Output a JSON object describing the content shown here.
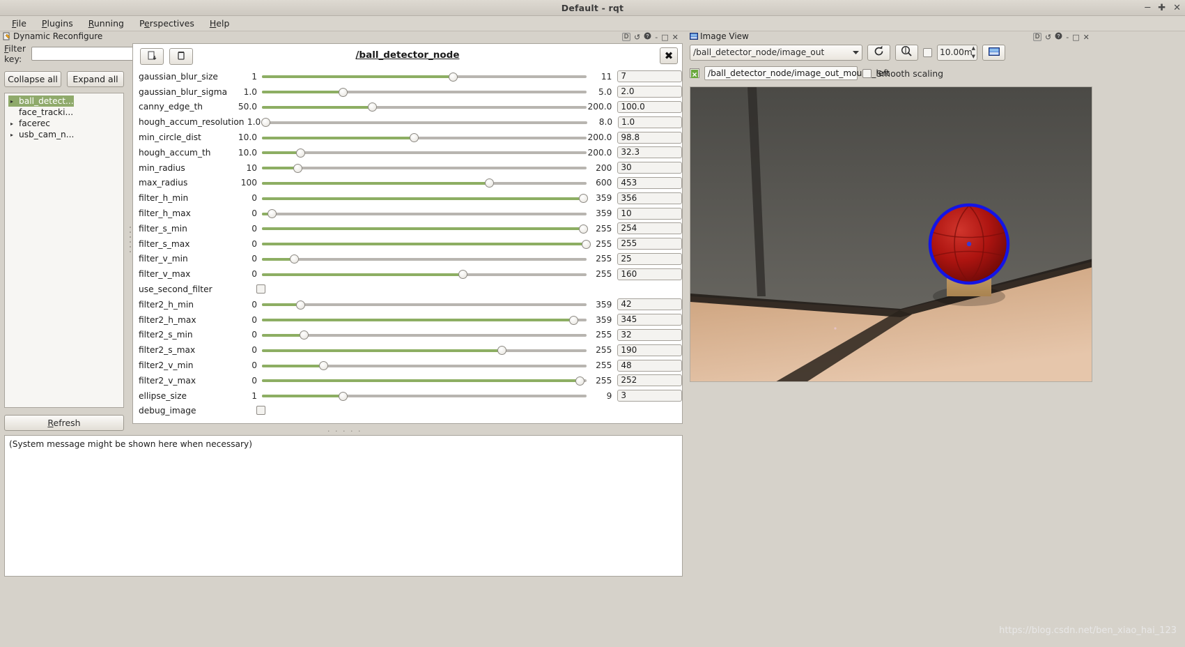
{
  "window": {
    "title": "Default - rqt",
    "buttons": [
      "minimize",
      "maximize",
      "close"
    ],
    "min_glyph": "─",
    "max_glyph": "✚",
    "close_glyph": "✕"
  },
  "menubar": {
    "items": [
      {
        "label": "File",
        "accel": "F"
      },
      {
        "label": "Plugins",
        "accel": "P"
      },
      {
        "label": "Running",
        "accel": "R"
      },
      {
        "label": "Perspectives",
        "accel": "e"
      },
      {
        "label": "Help",
        "accel": "H"
      }
    ]
  },
  "docks": {
    "dynamic_reconfigure": {
      "title": "Dynamic Reconfigure",
      "icon": "dynamic-reconfigure-icon",
      "buttons": [
        "D",
        "↺",
        "?",
        "-",
        "□",
        "✕"
      ]
    },
    "image_view": {
      "title": "Image View",
      "icon": "image-view-icon",
      "buttons": [
        "D",
        "↺",
        "?",
        "-",
        "□",
        "✕"
      ]
    }
  },
  "sidebar": {
    "filter_label": "Filter key:",
    "filter_value": "",
    "filter_placeholder": "",
    "collapse_all": "Collapse all",
    "expand_all": "Expand all",
    "refresh": "Refresh",
    "tree": [
      {
        "label": "ball_detect...",
        "expandable": true,
        "selected": true
      },
      {
        "label": "face_tracki...",
        "expandable": false,
        "selected": false
      },
      {
        "label": "facerec",
        "expandable": true,
        "selected": false
      },
      {
        "label": "usb_cam_n...",
        "expandable": true,
        "selected": false
      }
    ]
  },
  "param_panel": {
    "node_title": "/ball_detector_node",
    "toolbar": {
      "save_icon": "save-file-icon",
      "load_icon": "load-file-icon",
      "close_label": "✖"
    },
    "params": [
      {
        "name": "gaussian_blur_size",
        "min": "1",
        "max": "11",
        "value": "7",
        "type": "slider",
        "pct": 59
      },
      {
        "name": "gaussian_blur_sigma",
        "min": "1.0",
        "max": "5.0",
        "value": "2.0",
        "type": "slider",
        "pct": 25
      },
      {
        "name": "canny_edge_th",
        "min": "50.0",
        "max": "200.0",
        "value": "100.0",
        "type": "slider",
        "pct": 34
      },
      {
        "name": "hough_accum_resolution",
        "min": "1.0",
        "max": "8.0",
        "value": "1.0",
        "type": "slider",
        "pct": 0
      },
      {
        "name": "min_circle_dist",
        "min": "10.0",
        "max": "200.0",
        "value": "98.8",
        "type": "slider",
        "pct": 47
      },
      {
        "name": "hough_accum_th",
        "min": "10.0",
        "max": "200.0",
        "value": "32.3",
        "type": "slider",
        "pct": 12
      },
      {
        "name": "min_radius",
        "min": "10",
        "max": "200",
        "value": "30",
        "type": "slider",
        "pct": 11
      },
      {
        "name": "max_radius",
        "min": "100",
        "max": "600",
        "value": "453",
        "type": "slider",
        "pct": 70
      },
      {
        "name": "filter_h_min",
        "min": "0",
        "max": "359",
        "value": "356",
        "type": "slider",
        "pct": 99
      },
      {
        "name": "filter_h_max",
        "min": "0",
        "max": "359",
        "value": "10",
        "type": "slider",
        "pct": 3
      },
      {
        "name": "filter_s_min",
        "min": "0",
        "max": "255",
        "value": "254",
        "type": "slider",
        "pct": 99
      },
      {
        "name": "filter_s_max",
        "min": "0",
        "max": "255",
        "value": "255",
        "type": "slider",
        "pct": 100
      },
      {
        "name": "filter_v_min",
        "min": "0",
        "max": "255",
        "value": "25",
        "type": "slider",
        "pct": 10
      },
      {
        "name": "filter_v_max",
        "min": "0",
        "max": "255",
        "value": "160",
        "type": "slider",
        "pct": 62
      },
      {
        "name": "use_second_filter",
        "min": "",
        "max": "",
        "value": "",
        "type": "checkbox",
        "checked": false
      },
      {
        "name": "filter2_h_min",
        "min": "0",
        "max": "359",
        "value": "42",
        "type": "slider",
        "pct": 12
      },
      {
        "name": "filter2_h_max",
        "min": "0",
        "max": "359",
        "value": "345",
        "type": "slider",
        "pct": 96
      },
      {
        "name": "filter2_s_min",
        "min": "0",
        "max": "255",
        "value": "32",
        "type": "slider",
        "pct": 13
      },
      {
        "name": "filter2_s_max",
        "min": "0",
        "max": "255",
        "value": "190",
        "type": "slider",
        "pct": 74
      },
      {
        "name": "filter2_v_min",
        "min": "0",
        "max": "255",
        "value": "48",
        "type": "slider",
        "pct": 19
      },
      {
        "name": "filter2_v_max",
        "min": "0",
        "max": "255",
        "value": "252",
        "type": "slider",
        "pct": 98
      },
      {
        "name": "ellipse_size",
        "min": "1",
        "max": "9",
        "value": "3",
        "type": "slider",
        "pct": 25
      },
      {
        "name": "debug_image",
        "min": "",
        "max": "",
        "value": "",
        "type": "checkbox",
        "checked": false
      }
    ]
  },
  "log": {
    "message": "(System message might be shown here when necessary)"
  },
  "image_view": {
    "topic_combo": "/ball_detector_node/image_out",
    "refresh_icon": "refresh-icon",
    "zoom_icon": "zoom-magnifier-icon",
    "dynamic_range_checked": false,
    "max_range_value": "10.00m",
    "save_icon": "save-image-icon",
    "publish_checkbox_icon": "close-x-icon",
    "mouse_topic": "/ball_detector_node/image_out_mouse_left",
    "smooth_scaling_label": "Smooth scaling",
    "smooth_scaling_checked": false,
    "detection": {
      "circle_color": "#1414e6",
      "center_dot_color": "#3b3bd0",
      "ball_color": "#b21410"
    }
  },
  "watermark": {
    "text": "https://blog.csdn.net/ben_xiao_hai_123",
    "color": "#ededed"
  }
}
